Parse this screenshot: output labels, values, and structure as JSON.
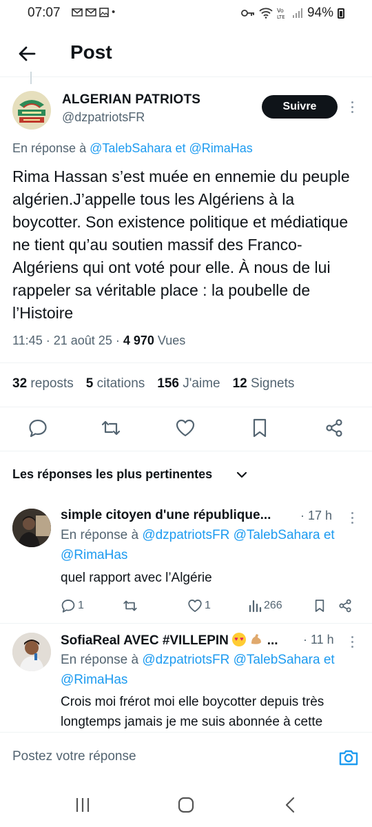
{
  "status_bar": {
    "time": "07:07",
    "battery": "94%"
  },
  "header": {
    "title": "Post"
  },
  "post": {
    "author_name": "ALGERIAN PATRIOTS",
    "author_handle": "@dzpatriotsFR",
    "follow_label": "Suivre",
    "reply_prefix": "En réponse à",
    "reply_mention_1": "@TalebSahara",
    "reply_connector": "et",
    "reply_mention_2": "@RimaHas",
    "text": "Rima Hassan s’est muée en ennemie du peuple algérien.J’appelle tous les Algériens à la boycotter. Son existence politique et médiatique ne tient qu’au soutien massif des Franco-Algériens qui ont voté pour elle. À nous de lui rappeler sa véritable place : la poubelle de l’Histoire",
    "time": "11:45",
    "date": "21 août 25",
    "views_count": "4 970",
    "views_label": "Vues",
    "separator": "·"
  },
  "stats": [
    {
      "count": "32",
      "label": "reposts"
    },
    {
      "count": "5",
      "label": "citations"
    },
    {
      "count": "156",
      "label": "J'aime"
    },
    {
      "count": "12",
      "label": "Signets"
    }
  ],
  "actions": [
    "reply-icon",
    "repost-icon",
    "like-icon",
    "bookmark-icon",
    "share-icon"
  ],
  "sort": {
    "label": "Les réponses les plus pertinentes"
  },
  "replies": [
    {
      "name": "simple citoyen d'une république...",
      "time": "· 17 h",
      "reply_prefix": "En réponse à",
      "mentions_line_1": "@dzpatriotsFR @TalebSahara",
      "connector": "et",
      "mentions_line_2": "@RimaHas",
      "text": "quel rapport avec l’Algérie",
      "reply_count": "1",
      "like_count": "1",
      "views": "266"
    },
    {
      "name": "SofiaReal AVEC #VILLEPIN",
      "name_suffix": "...",
      "time": "· 11 h",
      "reply_prefix": "En réponse à",
      "mentions_line_1": "@dzpatriotsFR @TalebSahara",
      "connector": "et",
      "mentions_line_2": "@RimaHas",
      "text": "Crois moi frérot moi elle boycotter depuis très longtemps jamais je me suis abonnée  à cette"
    }
  ],
  "composer": {
    "placeholder": "Postez votre réponse"
  },
  "colors": {
    "accent": "#1d9bf0",
    "text": "#0f1419",
    "secondary": "#536471",
    "follow_bg": "#0f1419"
  }
}
